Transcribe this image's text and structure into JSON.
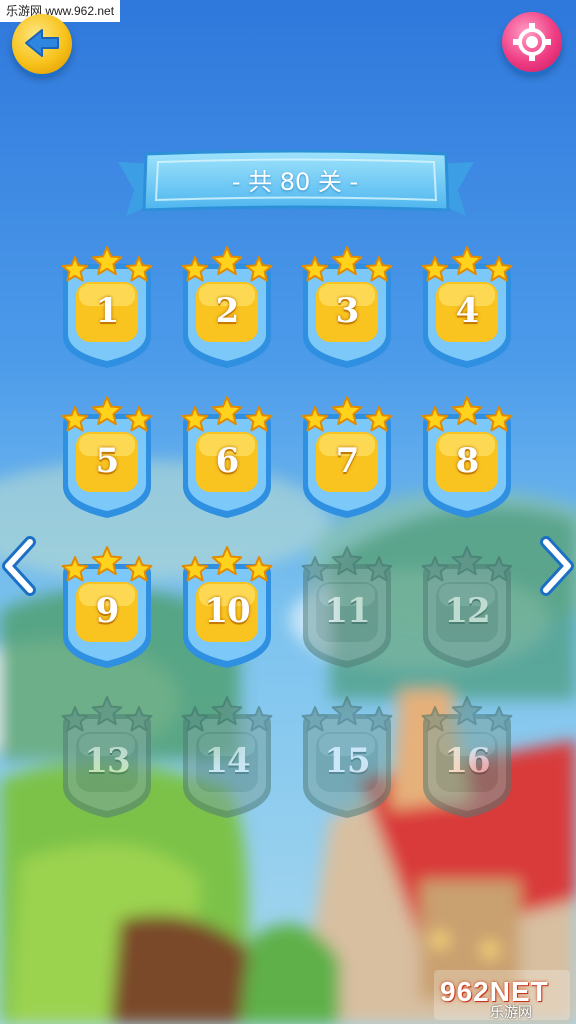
{
  "watermark_top": "乐游网 www.962.net",
  "title_banner": "- 共 80 关 -",
  "levels": [
    {
      "number": "1",
      "stars": 3,
      "locked": false
    },
    {
      "number": "2",
      "stars": 3,
      "locked": false
    },
    {
      "number": "3",
      "stars": 3,
      "locked": false
    },
    {
      "number": "4",
      "stars": 3,
      "locked": false
    },
    {
      "number": "5",
      "stars": 3,
      "locked": false
    },
    {
      "number": "6",
      "stars": 3,
      "locked": false
    },
    {
      "number": "7",
      "stars": 3,
      "locked": false
    },
    {
      "number": "8",
      "stars": 3,
      "locked": false
    },
    {
      "number": "9",
      "stars": 3,
      "locked": false
    },
    {
      "number": "10",
      "stars": 3,
      "locked": false
    },
    {
      "number": "11",
      "stars": 0,
      "locked": true
    },
    {
      "number": "12",
      "stars": 0,
      "locked": true
    },
    {
      "number": "13",
      "stars": 0,
      "locked": true
    },
    {
      "number": "14",
      "stars": 0,
      "locked": true
    },
    {
      "number": "15",
      "stars": 0,
      "locked": true
    },
    {
      "number": "16",
      "stars": 0,
      "locked": true
    }
  ],
  "watermark_bottom": {
    "brand": "962NET",
    "sub": "乐游网"
  },
  "icons": {
    "back": "arrow-left-icon",
    "settings": "gear-icon",
    "prev": "chevron-left-icon",
    "next": "chevron-right-icon",
    "star": "star-icon"
  },
  "colors": {
    "sky": "#3f8fe6",
    "gold": "#f7c21a",
    "badge_blue": "#4aa8f0",
    "settings_pink": "#ef3c83",
    "locked": "#5f8a86"
  }
}
